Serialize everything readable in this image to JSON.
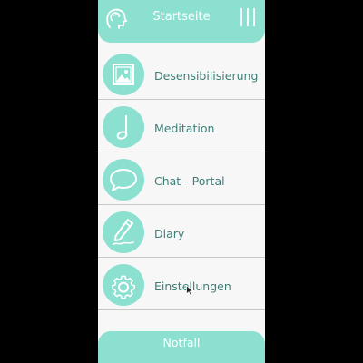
{
  "header": {
    "title": "Startseite",
    "logo_icon": "head-profile-icon",
    "menu_icon": "menu-bars-icon"
  },
  "menu": {
    "items": [
      {
        "label": "Desensibilisierung",
        "icon": "picture-icon"
      },
      {
        "label": "Meditation",
        "icon": "music-note-icon"
      },
      {
        "label": "Chat - Portal",
        "icon": "chat-bubble-icon"
      },
      {
        "label": "Diary",
        "icon": "pencil-icon"
      },
      {
        "label": "Einstellungen",
        "icon": "gear-icon"
      }
    ]
  },
  "footer": {
    "label": "Notfall"
  },
  "colors": {
    "accent": "#8be0d0",
    "label_text": "#3e7e78",
    "background": "#f7f7f7",
    "divider": "#c9c9c9"
  }
}
